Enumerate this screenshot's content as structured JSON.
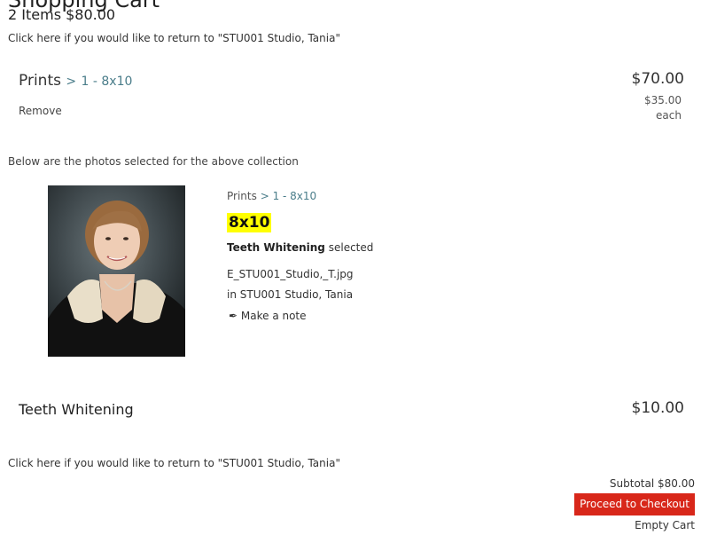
{
  "page": {
    "heading": "Shopping Cart",
    "items_summary": "2 Items $80.00",
    "return_link": "Click here if you would like to return to \"STU001 Studio, Tania\""
  },
  "line_item": {
    "category": "Prints",
    "separator": ">",
    "crumb": "1 - 8x10",
    "price": "$70.00",
    "unit_price": "$35.00",
    "unit_label": "each",
    "remove_label": "Remove"
  },
  "photos_note": "Below are the photos selected for the above collection",
  "photo": {
    "crumb_category": "Prints",
    "crumb_separator": ">",
    "crumb": "1 - 8x10",
    "size": "8x10",
    "option_name": "Teeth Whitening",
    "option_suffix": "selected",
    "filename": "E_STU001_Studio,_T.jpg",
    "studio": "in STU001 Studio, Tania",
    "note_icon": "pen-nib-icon",
    "note_label": "Make a note"
  },
  "addon": {
    "title": "Teeth Whitening",
    "price": "$10.00"
  },
  "footer": {
    "return_link": "Click here if you would like to return to \"STU001 Studio, Tania\"",
    "subtotal": "Subtotal $80.00",
    "checkout_label": "Proceed to Checkout",
    "empty_cart_label": "Empty Cart"
  },
  "colors": {
    "checkout_bg": "#d8271a",
    "size_highlight": "#ffff00",
    "crumb": "#4a7d8a"
  }
}
